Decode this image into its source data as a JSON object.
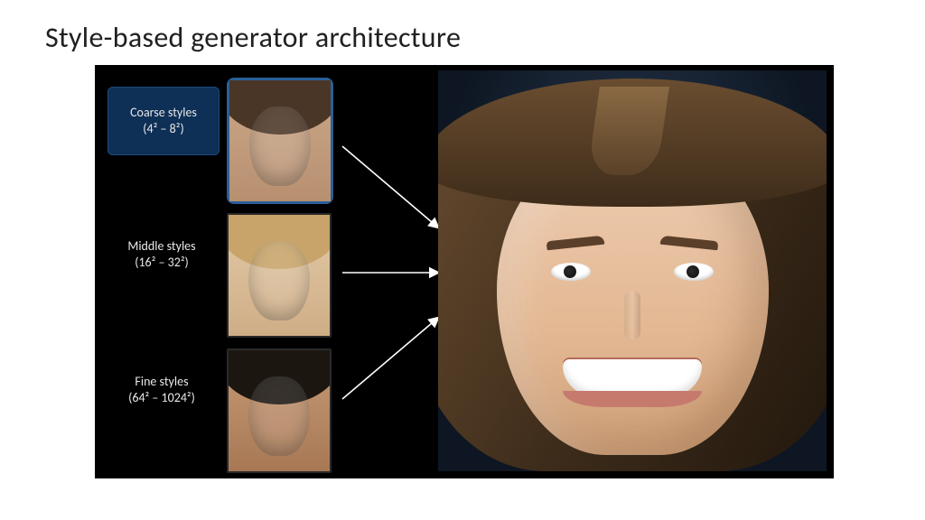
{
  "title": "Style-based generator architecture",
  "levels": [
    {
      "name": "Coarse styles",
      "range": "(4² – 8²)",
      "selected": true
    },
    {
      "name": "Middle styles",
      "range": "(16² – 32²)",
      "selected": false
    },
    {
      "name": "Fine styles",
      "range": "(64² – 1024²)",
      "selected": false
    }
  ]
}
